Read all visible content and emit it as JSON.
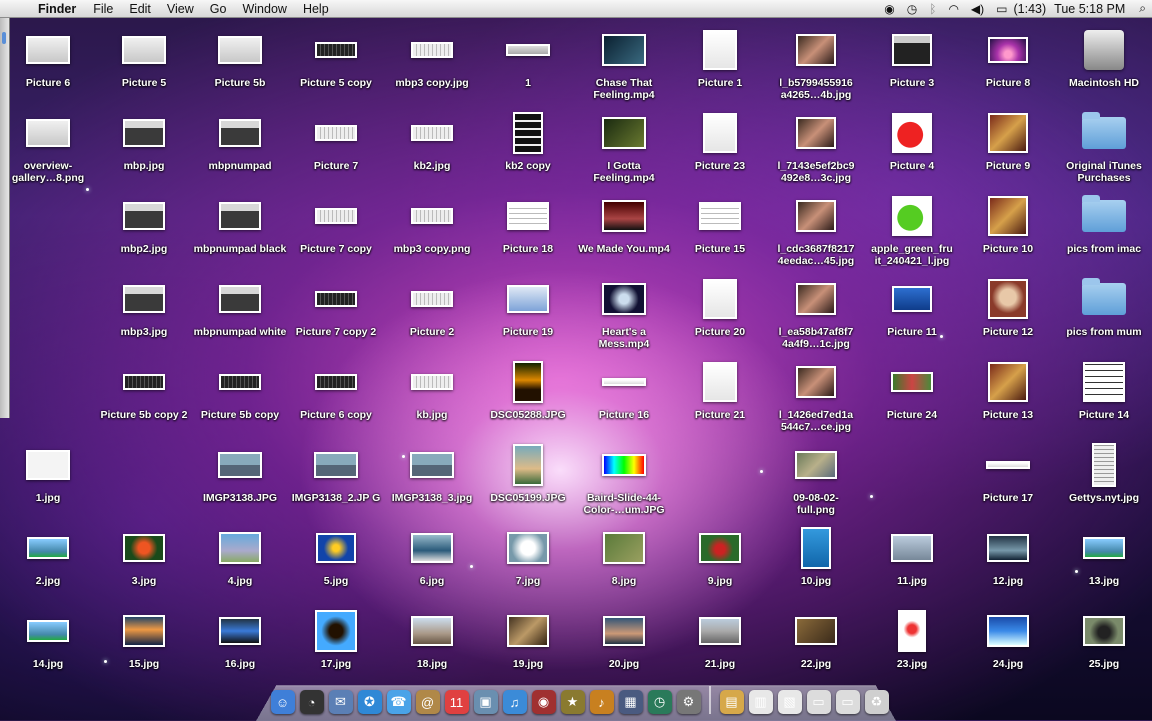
{
  "menubar": {
    "app_name": "Finder",
    "menus": [
      "File",
      "Edit",
      "View",
      "Go",
      "Window",
      "Help"
    ],
    "battery_text": "(1:43)",
    "clock": "Tue 5:18 PM"
  },
  "desktop": {
    "icons": [
      {
        "label": "Picture 6",
        "thumb": "mac-window",
        "col": 0,
        "row": 0
      },
      {
        "label": "Picture 5",
        "thumb": "mac-window",
        "col": 1,
        "row": 0
      },
      {
        "label": "Picture 5b",
        "thumb": "mac-window",
        "col": 2,
        "row": 0
      },
      {
        "label": "Picture 5 copy",
        "thumb": "keyboard-dark",
        "col": 3,
        "row": 0
      },
      {
        "label": "mbp3 copy.jpg",
        "thumb": "keyboard-light",
        "col": 4,
        "row": 0
      },
      {
        "label": "1",
        "thumb": "bar-gray",
        "col": 5,
        "row": 0
      },
      {
        "label": "Chase That Feeling.mp4",
        "thumb": "video-dark",
        "col": 6,
        "row": 0
      },
      {
        "label": "Picture 1",
        "thumb": "doc-white",
        "col": 7,
        "row": 0
      },
      {
        "label": "l_b5799455916 a4265…4b.jpg",
        "thumb": "photo-people",
        "col": 8,
        "row": 0
      },
      {
        "label": "Picture 3",
        "thumb": "quicktime",
        "col": 9,
        "row": 0
      },
      {
        "label": "Picture 8",
        "thumb": "leopard-pink",
        "col": 10,
        "row": 0
      },
      {
        "label": "Macintosh HD",
        "thumb": "hard-drive",
        "col": 11,
        "row": 0
      },
      {
        "label": "overview-\ngallery…8.png",
        "thumb": "mac-window",
        "col": 0,
        "row": 1
      },
      {
        "label": "mbp.jpg",
        "thumb": "laptop",
        "col": 1,
        "row": 1
      },
      {
        "label": "mbpnumpad",
        "thumb": "laptop",
        "col": 2,
        "row": 1
      },
      {
        "label": "Picture 7",
        "thumb": "keyboard-light",
        "col": 3,
        "row": 1
      },
      {
        "label": "kb2.jpg",
        "thumb": "keyboard-light",
        "col": 4,
        "row": 1
      },
      {
        "label": "kb2 copy",
        "thumb": "keypad",
        "col": 5,
        "row": 1
      },
      {
        "label": "I Gotta Feeling.mp4",
        "thumb": "video-green",
        "col": 6,
        "row": 1
      },
      {
        "label": "Picture 23",
        "thumb": "doc-white",
        "col": 7,
        "row": 1
      },
      {
        "label": "l_7143e5ef2bc9 492e8…3c.jpg",
        "thumb": "photo-people",
        "col": 8,
        "row": 1
      },
      {
        "label": "Picture 4",
        "thumb": "apple-red",
        "col": 9,
        "row": 1
      },
      {
        "label": "Picture 9",
        "thumb": "album",
        "col": 10,
        "row": 1
      },
      {
        "label": "Original iTunes Purchases",
        "thumb": "folder",
        "col": 11,
        "row": 1
      },
      {
        "label": "mbp2.jpg",
        "thumb": "laptop",
        "col": 1,
        "row": 2
      },
      {
        "label": "mbpnumpad black",
        "thumb": "laptop",
        "col": 2,
        "row": 2
      },
      {
        "label": "Picture 7 copy",
        "thumb": "keyboard-light",
        "col": 3,
        "row": 2
      },
      {
        "label": "mbp3 copy.png",
        "thumb": "keyboard-light",
        "col": 4,
        "row": 2
      },
      {
        "label": "Picture 18",
        "thumb": "doc-table",
        "col": 5,
        "row": 2
      },
      {
        "label": "We Made You.mp4",
        "thumb": "video-stage",
        "col": 6,
        "row": 2
      },
      {
        "label": "Picture 15",
        "thumb": "doc-table",
        "col": 7,
        "row": 2
      },
      {
        "label": "l_cdc3687f8217 4eedac…45.jpg",
        "thumb": "photo-people",
        "col": 8,
        "row": 2
      },
      {
        "label": "apple_green_fru it_240421_l.jpg",
        "thumb": "apple-green",
        "col": 9,
        "row": 2
      },
      {
        "label": "Picture 10",
        "thumb": "album",
        "col": 10,
        "row": 2
      },
      {
        "label": "pics from imac",
        "thumb": "folder",
        "col": 11,
        "row": 2
      },
      {
        "label": "mbp3.jpg",
        "thumb": "laptop",
        "col": 1,
        "row": 3
      },
      {
        "label": "mbpnumpad white",
        "thumb": "laptop",
        "col": 2,
        "row": 3
      },
      {
        "label": "Picture 7 copy 2",
        "thumb": "keyboard-dark",
        "col": 3,
        "row": 3
      },
      {
        "label": "Picture 2",
        "thumb": "keyboard-light",
        "col": 4,
        "row": 3
      },
      {
        "label": "Picture 19",
        "thumb": "screen-blue",
        "col": 5,
        "row": 3
      },
      {
        "label": "Heart's a Mess.mp4",
        "thumb": "video-moon",
        "col": 6,
        "row": 3
      },
      {
        "label": "Picture 20",
        "thumb": "doc-white",
        "col": 7,
        "row": 3
      },
      {
        "label": "l_ea58b47af8f7 4a4f9…1c.jpg",
        "thumb": "photo-people",
        "col": 8,
        "row": 3
      },
      {
        "label": "Picture 11",
        "thumb": "laptop-blue",
        "col": 9,
        "row": 3
      },
      {
        "label": "Picture 12",
        "thumb": "album-face",
        "col": 10,
        "row": 3
      },
      {
        "label": "pics from mum",
        "thumb": "folder",
        "col": 11,
        "row": 3
      },
      {
        "label": "Picture 5b copy 2",
        "thumb": "keyboard-dark",
        "col": 1,
        "row": 4
      },
      {
        "label": "Picture 5b copy",
        "thumb": "keyboard-dark",
        "col": 2,
        "row": 4
      },
      {
        "label": "Picture 6 copy",
        "thumb": "keyboard-dark",
        "col": 3,
        "row": 4
      },
      {
        "label": "kb.jpg",
        "thumb": "keyboard-light",
        "col": 4,
        "row": 4
      },
      {
        "label": "DSC05288.JPG",
        "thumb": "sunset",
        "col": 5,
        "row": 4
      },
      {
        "label": "Picture 16",
        "thumb": "bar-white",
        "col": 6,
        "row": 4
      },
      {
        "label": "Picture 21",
        "thumb": "doc-white",
        "col": 7,
        "row": 4
      },
      {
        "label": "l_1426ed7ed1a 544c7…ce.jpg",
        "thumb": "photo-people",
        "col": 8,
        "row": 4
      },
      {
        "label": "Picture 24",
        "thumb": "photo-green",
        "col": 9,
        "row": 4
      },
      {
        "label": "Picture 13",
        "thumb": "album",
        "col": 10,
        "row": 4
      },
      {
        "label": "Picture 14",
        "thumb": "sheet-music",
        "col": 11,
        "row": 4
      },
      {
        "label": "1.jpg",
        "thumb": "white-sketch",
        "col": 0,
        "row": 5
      },
      {
        "label": "IMGP3138.JPG",
        "thumb": "bridge",
        "col": 2,
        "row": 5
      },
      {
        "label": "IMGP3138_2.JP G",
        "thumb": "bridge",
        "col": 3,
        "row": 5
      },
      {
        "label": "IMGP3138_3.jpg",
        "thumb": "bridge",
        "col": 4,
        "row": 5
      },
      {
        "label": "DSC05199.JPG",
        "thumb": "photo-beach",
        "col": 5,
        "row": 5
      },
      {
        "label": "Baird-Slide-44-\nColor-…um.JPG",
        "thumb": "spectrum",
        "col": 6,
        "row": 5
      },
      {
        "label": "09-08-02-\nfull.png",
        "thumb": "map",
        "col": 8,
        "row": 5
      },
      {
        "label": "Picture 17",
        "thumb": "bar-white",
        "col": 10,
        "row": 5
      },
      {
        "label": "Gettys.nyt.jpg",
        "thumb": "newspaper",
        "col": 11,
        "row": 5
      },
      {
        "label": "2.jpg",
        "thumb": "sky-sea",
        "col": 0,
        "row": 6
      },
      {
        "label": "3.jpg",
        "thumb": "bird-red",
        "col": 1,
        "row": 6
      },
      {
        "label": "4.jpg",
        "thumb": "paraglide",
        "col": 2,
        "row": 6
      },
      {
        "label": "5.jpg",
        "thumb": "bird-blue",
        "col": 3,
        "row": 6
      },
      {
        "label": "6.jpg",
        "thumb": "wave",
        "col": 4,
        "row": 6
      },
      {
        "label": "7.jpg",
        "thumb": "cloud",
        "col": 5,
        "row": 6
      },
      {
        "label": "8.jpg",
        "thumb": "dragonfly",
        "col": 6,
        "row": 6
      },
      {
        "label": "9.jpg",
        "thumb": "frog",
        "col": 7,
        "row": 6
      },
      {
        "label": "10.jpg",
        "thumb": "plane-blue",
        "col": 8,
        "row": 6
      },
      {
        "label": "11.jpg",
        "thumb": "jet",
        "col": 9,
        "row": 6
      },
      {
        "label": "12.jpg",
        "thumb": "sky-dark",
        "col": 10,
        "row": 6
      },
      {
        "label": "13.jpg",
        "thumb": "sky-sea",
        "col": 11,
        "row": 6
      },
      {
        "label": "14.jpg",
        "thumb": "sky-sea",
        "col": 0,
        "row": 7
      },
      {
        "label": "15.jpg",
        "thumb": "sunset-sea",
        "col": 1,
        "row": 7
      },
      {
        "label": "16.jpg",
        "thumb": "car-blue",
        "col": 2,
        "row": 7
      },
      {
        "label": "17.jpg",
        "thumb": "eagle",
        "col": 3,
        "row": 7
      },
      {
        "label": "18.jpg",
        "thumb": "beach",
        "col": 4,
        "row": 7
      },
      {
        "label": "19.jpg",
        "thumb": "room",
        "col": 5,
        "row": 7
      },
      {
        "label": "20.jpg",
        "thumb": "sky-dusk",
        "col": 6,
        "row": 7
      },
      {
        "label": "21.jpg",
        "thumb": "cars",
        "col": 7,
        "row": 7
      },
      {
        "label": "22.jpg",
        "thumb": "lizard",
        "col": 8,
        "row": 7
      },
      {
        "label": "23.jpg",
        "thumb": "dancer",
        "col": 9,
        "row": 7
      },
      {
        "label": "24.jpg",
        "thumb": "ocean",
        "col": 10,
        "row": 7
      },
      {
        "label": "25.jpg",
        "thumb": "snail",
        "col": 11,
        "row": 7
      }
    ]
  },
  "dock": {
    "apps": [
      {
        "name": "finder-icon",
        "glyph": "☺",
        "color": "#3f7fd8"
      },
      {
        "name": "dashboard-icon",
        "glyph": "◔",
        "color": "#333333"
      },
      {
        "name": "mail-icon",
        "glyph": "✉",
        "color": "#5b7fb5"
      },
      {
        "name": "safari-icon",
        "glyph": "✪",
        "color": "#2f88d6"
      },
      {
        "name": "ichat-icon",
        "glyph": "☎",
        "color": "#4aa3e8"
      },
      {
        "name": "address-book-icon",
        "glyph": "@",
        "color": "#b08848"
      },
      {
        "name": "ical-icon",
        "glyph": "11",
        "color": "#e04040"
      },
      {
        "name": "iphoto-icon",
        "glyph": "▣",
        "color": "#6a8fb0"
      },
      {
        "name": "itunes-icon",
        "glyph": "♫",
        "color": "#3b8bd8"
      },
      {
        "name": "photo-booth-icon",
        "glyph": "◉",
        "color": "#a03030"
      },
      {
        "name": "imovie-icon",
        "glyph": "★",
        "color": "#8a7a30"
      },
      {
        "name": "garageband-icon",
        "glyph": "♪",
        "color": "#c88020"
      },
      {
        "name": "spaces-icon",
        "glyph": "▦",
        "color": "#4a5a80"
      },
      {
        "name": "time-machine-icon",
        "glyph": "◷",
        "color": "#2a7a5a"
      },
      {
        "name": "system-preferences-icon",
        "glyph": "⚙",
        "color": "#777777"
      }
    ],
    "stacks": [
      {
        "name": "applications-stack-icon",
        "glyph": "▤",
        "color": "#d6a84a"
      },
      {
        "name": "documents-stack-icon",
        "glyph": "▥",
        "color": "#e8e8e8"
      },
      {
        "name": "downloads-stack-icon",
        "glyph": "▧",
        "color": "#e8e8e8"
      },
      {
        "name": "screenshot-stack-icon",
        "glyph": "▭",
        "color": "#dcdcdc"
      },
      {
        "name": "pictures-stack-icon",
        "glyph": "▭",
        "color": "#dcdcdc"
      },
      {
        "name": "trash-icon",
        "glyph": "♻",
        "color": "#cfcfcf"
      }
    ]
  }
}
